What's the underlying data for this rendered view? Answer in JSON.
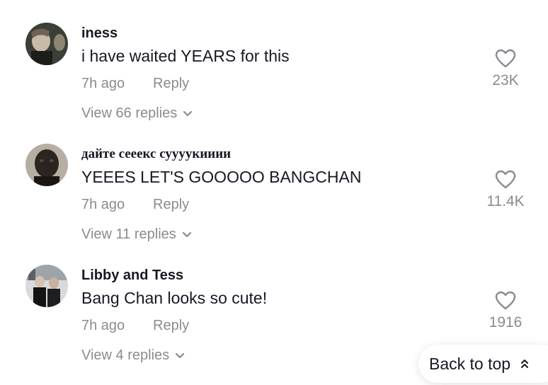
{
  "comments": [
    {
      "username": "iness",
      "text": "i have waited YEARS for this",
      "time": "7h ago",
      "reply_label": "Reply",
      "view_replies": "View 66 replies",
      "likes": "23K"
    },
    {
      "username": "дайте сееекс суууукииии",
      "text": "YEEES LET'S GOOOOO BANGCHAN",
      "time": "7h ago",
      "reply_label": "Reply",
      "view_replies": "View 11 replies",
      "likes": "11.4K"
    },
    {
      "username": "Libby and Tess",
      "text": "Bang Chan looks so cute!",
      "time": "7h ago",
      "reply_label": "Reply",
      "view_replies": "View 4 replies",
      "likes": "1916"
    }
  ],
  "back_to_top": {
    "label": "Back to top",
    "icon": "double-chevron-up-icon"
  },
  "colors": {
    "primary_text": "#161823",
    "secondary_text": "#8a8b91",
    "background": "#ffffff"
  }
}
